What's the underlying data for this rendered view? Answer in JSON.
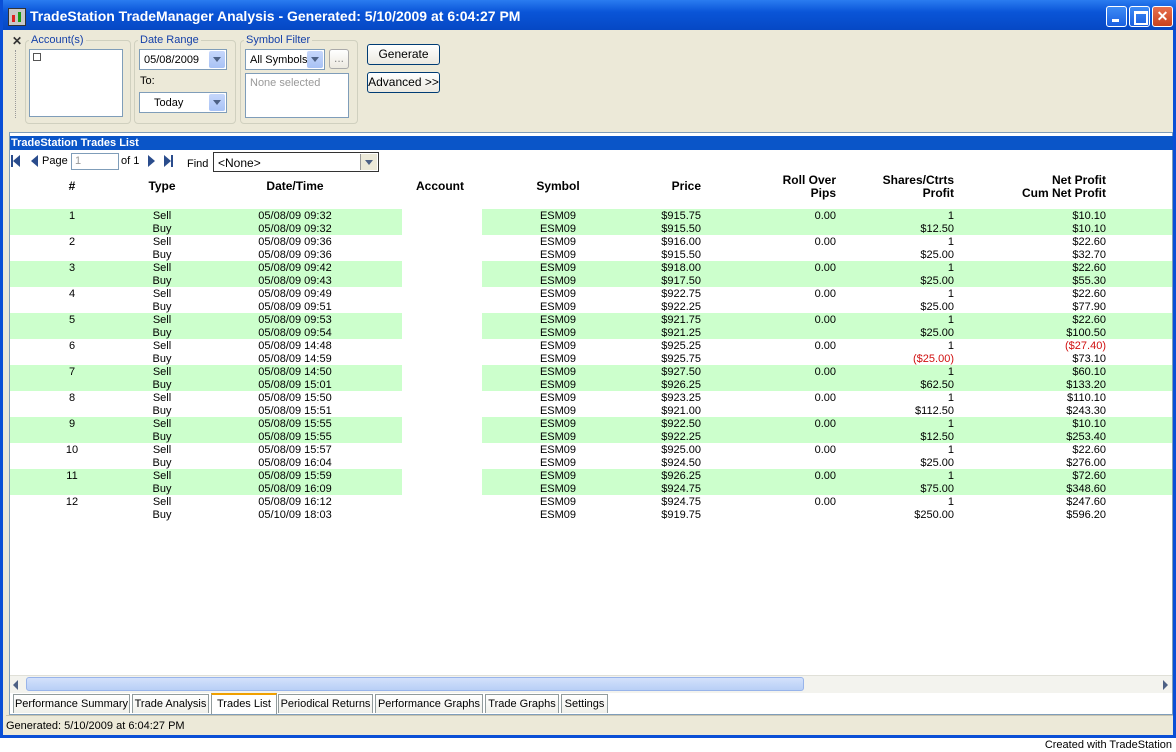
{
  "window": {
    "title": "TradeStation TradeManager Analysis - Generated: 5/10/2009 at 6:04:27 PM"
  },
  "toolbar": {
    "accounts_legend": "Account(s)",
    "date_range_legend": "Date Range",
    "from_date": "05/08/2009",
    "to_label": "To:",
    "to_date": "Today",
    "symbol_filter_legend": "Symbol Filter",
    "symbol_filter": "All Symbols",
    "symbol_browse": "...",
    "symbol_selected_placeholder": "None selected",
    "generate_label": "Generate",
    "advanced_label": "Advanced >>"
  },
  "trades_list": {
    "header": "TradeStation Trades List",
    "page_label": "Page",
    "page_value": "1",
    "of_label": "of 1",
    "find_label": "Find",
    "find_value": "<None>",
    "columns": {
      "num": "#",
      "type": "Type",
      "datetime": "Date/Time",
      "account": "Account",
      "symbol": "Symbol",
      "price": "Price",
      "rollover": "Roll Over",
      "pips": "Pips",
      "shares": "Shares/Ctrts",
      "profit": "Profit",
      "net_profit": "Net Profit",
      "cum_net_profit": "Cum Net Profit"
    },
    "trades": [
      {
        "num": "1",
        "entry": {
          "type": "Sell",
          "dt": "05/08/09 09:32",
          "symbol": "ESM09",
          "price": "$915.75",
          "pips": "0.00",
          "shares": "1",
          "net": "$10.10"
        },
        "exit": {
          "type": "Buy",
          "dt": "05/08/09 09:32",
          "symbol": "ESM09",
          "price": "$915.50",
          "profit": "$12.50",
          "cum": "$10.10"
        }
      },
      {
        "num": "2",
        "entry": {
          "type": "Sell",
          "dt": "05/08/09 09:36",
          "symbol": "ESM09",
          "price": "$916.00",
          "pips": "0.00",
          "shares": "1",
          "net": "$22.60"
        },
        "exit": {
          "type": "Buy",
          "dt": "05/08/09 09:36",
          "symbol": "ESM09",
          "price": "$915.50",
          "profit": "$25.00",
          "cum": "$32.70"
        }
      },
      {
        "num": "3",
        "entry": {
          "type": "Sell",
          "dt": "05/08/09 09:42",
          "symbol": "ESM09",
          "price": "$918.00",
          "pips": "0.00",
          "shares": "1",
          "net": "$22.60"
        },
        "exit": {
          "type": "Buy",
          "dt": "05/08/09 09:43",
          "symbol": "ESM09",
          "price": "$917.50",
          "profit": "$25.00",
          "cum": "$55.30"
        }
      },
      {
        "num": "4",
        "entry": {
          "type": "Sell",
          "dt": "05/08/09 09:49",
          "symbol": "ESM09",
          "price": "$922.75",
          "pips": "0.00",
          "shares": "1",
          "net": "$22.60"
        },
        "exit": {
          "type": "Buy",
          "dt": "05/08/09 09:51",
          "symbol": "ESM09",
          "price": "$922.25",
          "profit": "$25.00",
          "cum": "$77.90"
        }
      },
      {
        "num": "5",
        "entry": {
          "type": "Sell",
          "dt": "05/08/09 09:53",
          "symbol": "ESM09",
          "price": "$921.75",
          "pips": "0.00",
          "shares": "1",
          "net": "$22.60"
        },
        "exit": {
          "type": "Buy",
          "dt": "05/08/09 09:54",
          "symbol": "ESM09",
          "price": "$921.25",
          "profit": "$25.00",
          "cum": "$100.50"
        }
      },
      {
        "num": "6",
        "entry": {
          "type": "Sell",
          "dt": "05/08/09 14:48",
          "symbol": "ESM09",
          "price": "$925.25",
          "pips": "0.00",
          "shares": "1",
          "net": "($27.40)"
        },
        "exit": {
          "type": "Buy",
          "dt": "05/08/09 14:59",
          "symbol": "ESM09",
          "price": "$925.75",
          "profit": "($25.00)",
          "cum": "$73.10"
        }
      },
      {
        "num": "7",
        "entry": {
          "type": "Sell",
          "dt": "05/08/09 14:50",
          "symbol": "ESM09",
          "price": "$927.50",
          "pips": "0.00",
          "shares": "1",
          "net": "$60.10"
        },
        "exit": {
          "type": "Buy",
          "dt": "05/08/09 15:01",
          "symbol": "ESM09",
          "price": "$926.25",
          "profit": "$62.50",
          "cum": "$133.20"
        }
      },
      {
        "num": "8",
        "entry": {
          "type": "Sell",
          "dt": "05/08/09 15:50",
          "symbol": "ESM09",
          "price": "$923.25",
          "pips": "0.00",
          "shares": "1",
          "net": "$110.10"
        },
        "exit": {
          "type": "Buy",
          "dt": "05/08/09 15:51",
          "symbol": "ESM09",
          "price": "$921.00",
          "profit": "$112.50",
          "cum": "$243.30"
        }
      },
      {
        "num": "9",
        "entry": {
          "type": "Sell",
          "dt": "05/08/09 15:55",
          "symbol": "ESM09",
          "price": "$922.50",
          "pips": "0.00",
          "shares": "1",
          "net": "$10.10"
        },
        "exit": {
          "type": "Buy",
          "dt": "05/08/09 15:55",
          "symbol": "ESM09",
          "price": "$922.25",
          "profit": "$12.50",
          "cum": "$253.40"
        }
      },
      {
        "num": "10",
        "entry": {
          "type": "Sell",
          "dt": "05/08/09 15:57",
          "symbol": "ESM09",
          "price": "$925.00",
          "pips": "0.00",
          "shares": "1",
          "net": "$22.60"
        },
        "exit": {
          "type": "Buy",
          "dt": "05/08/09 16:04",
          "symbol": "ESM09",
          "price": "$924.50",
          "profit": "$25.00",
          "cum": "$276.00"
        }
      },
      {
        "num": "11",
        "entry": {
          "type": "Sell",
          "dt": "05/08/09 15:59",
          "symbol": "ESM09",
          "price": "$926.25",
          "pips": "0.00",
          "shares": "1",
          "net": "$72.60"
        },
        "exit": {
          "type": "Buy",
          "dt": "05/08/09 16:09",
          "symbol": "ESM09",
          "price": "$924.75",
          "profit": "$75.00",
          "cum": "$348.60"
        }
      },
      {
        "num": "12",
        "entry": {
          "type": "Sell",
          "dt": "05/08/09 16:12",
          "symbol": "ESM09",
          "price": "$924.75",
          "pips": "0.00",
          "shares": "1",
          "net": "$247.60"
        },
        "exit": {
          "type": "Buy",
          "dt": "05/10/09 18:03",
          "symbol": "ESM09",
          "price": "$919.75",
          "profit": "$250.00",
          "cum": "$596.20"
        }
      }
    ]
  },
  "tabs": [
    "Performance Summary",
    "Trade Analysis",
    "Trades List",
    "Periodical Returns",
    "Performance Graphs",
    "Trade Graphs",
    "Settings"
  ],
  "active_tab": "Trades List",
  "status": {
    "text": "Generated: 5/10/2009 at 6:04:27 PM"
  },
  "footer": {
    "credit": "Created with TradeStation"
  },
  "colors": {
    "row_highlight": "#ccffcc",
    "negative": "#d01010",
    "header_bar": "#0a55c8"
  }
}
